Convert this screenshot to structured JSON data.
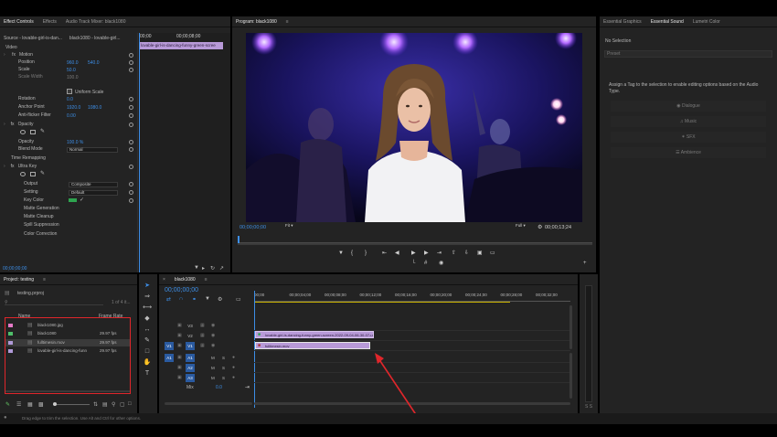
{
  "effect_controls": {
    "tabs": [
      {
        "label": "Effect Controls",
        "active": true
      },
      {
        "label": "Effects",
        "active": false
      },
      {
        "label": "Audio Track Mixer: black1080",
        "active": false
      }
    ],
    "source_label": "Source - lovable-girl-is-dan...",
    "sequence_label": "black1080 - lovable-girl...",
    "timeline_time": "00;00",
    "timeline_time2": "00;00;08;00",
    "clip_name": "lovable-girl-is-dancing-funny-green-scree",
    "section_video": "Video",
    "motion": "Motion",
    "position_label": "Position",
    "position_x": "960.0",
    "position_y": "540.0",
    "scale_label": "Scale",
    "scale_value": "50.0",
    "scale_width_label": "Scale Width",
    "scale_width_value": "100.0",
    "uniform_scale": "Uniform Scale",
    "rotation_label": "Rotation",
    "rotation_value": "0.0",
    "anchor_label": "Anchor Point",
    "anchor_x": "1920.0",
    "anchor_y": "1080.0",
    "antiflicker_label": "Anti-flicker Filter",
    "antiflicker_value": "0.00",
    "opacity_section": "Opacity",
    "opacity_label": "Opacity",
    "opacity_value": "100.0 %",
    "blend_label": "Blend Mode",
    "blend_value": "Normal",
    "time_remap": "Time Remapping",
    "ultra_key": "Ultra Key",
    "output_label": "Output",
    "output_value": "Composite",
    "setting_label": "Setting",
    "setting_value": "Default",
    "key_color_label": "Key Color",
    "matte_gen": "Matte Generation",
    "matte_clean": "Matte Cleanup",
    "spill": "Spill Suppression",
    "color_corr": "Color Correction",
    "bottom_time": "00;00;00;00"
  },
  "program": {
    "title": "Program: black1080",
    "timecode": "00;00;00;00",
    "fit": "Fit",
    "quality": "Full",
    "duration": "00;00;13;24"
  },
  "right_panel": {
    "tabs": [
      {
        "label": "Essential Graphics",
        "active": false
      },
      {
        "label": "Essential Sound",
        "active": true
      },
      {
        "label": "Lumetri Color",
        "active": false
      }
    ],
    "no_selection": "No Selection",
    "preset": "Preset",
    "assign_text": "Assign a Tag to the selection to enable editing options based on the Audio Type.",
    "types": [
      "Dialogue",
      "Music",
      "SFX",
      "Ambience"
    ]
  },
  "project": {
    "title": "Project: testing",
    "file": "testing.prproj",
    "count": "1 of 4 it...",
    "col_name": "Name",
    "col_fps": "Frame Rate",
    "items": [
      {
        "name": "black1080.jpg",
        "fps": "",
        "color": "#e57ac8"
      },
      {
        "name": "black1080",
        "fps": "29.97 fps",
        "color": "#4fbf6a"
      },
      {
        "name": "fulltimesin.mov",
        "fps": "29.97 fps",
        "color": "#b09ad8"
      },
      {
        "name": "lovable-girl-is-dancing-funn",
        "fps": "29.97 fps",
        "color": "#b09ad8"
      }
    ]
  },
  "timeline": {
    "title": "black1080",
    "timecode": "00;00;00;00",
    "ticks": [
      "00;00",
      "00;00;04;00",
      "00;00;08;00",
      "00;00;12;00",
      "00;00;16;00",
      "00;00;20;00",
      "00;00;24;00",
      "00;00;28;00",
      "00;00;32;00"
    ],
    "video_tracks": [
      "V3",
      "V2",
      "V1"
    ],
    "audio_tracks": [
      "A1",
      "A2",
      "A3"
    ],
    "source_v": "V1",
    "source_a": "A1",
    "mix_label": "Mix",
    "mix_value": "0.0",
    "clip_v2": "lovable-girl-is-dancing-funny-green-screen-2022-09-04-06-30-07-ut",
    "clip_v1": "fulltimesin.mov",
    "mute": "M",
    "solo": "S"
  },
  "status_bar": "Drag edge to trim the selection. Use Alt and Ctrl for other options.",
  "colors": {
    "accent": "#3d8ee6",
    "clip": "#b89ad8",
    "highlight": "#e0262b"
  }
}
